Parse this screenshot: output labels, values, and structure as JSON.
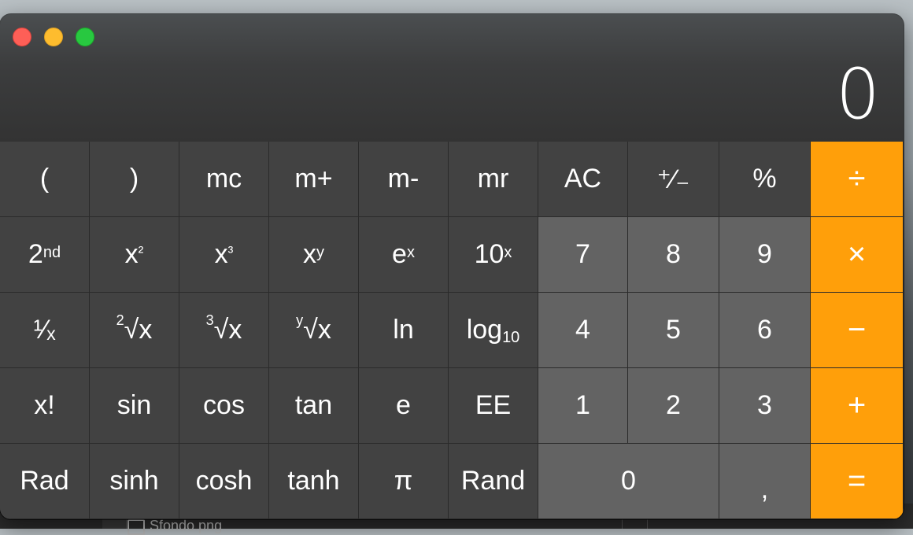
{
  "display": {
    "value": "0"
  },
  "row1": [
    "(",
    ")",
    "mc",
    "m+",
    "m-",
    "mr",
    "AC",
    "⁺∕₋",
    "%",
    "÷"
  ],
  "row2": {
    "second": {
      "base": "2",
      "sup": "nd"
    },
    "x2": {
      "base": "x",
      "sup": "²"
    },
    "x3": {
      "base": "x",
      "sup": "³"
    },
    "xy": {
      "base": "x",
      "sup": "y"
    },
    "ex": {
      "base": "e",
      "sup": "x"
    },
    "tenx": {
      "base": "10",
      "sup": "x"
    },
    "d7": "7",
    "d8": "8",
    "d9": "9",
    "mul": "×"
  },
  "row3": {
    "recip": "¹⁄ₓ",
    "sqrt2": {
      "pre": "2",
      "root": "√x"
    },
    "sqrt3": {
      "pre": "3",
      "root": "√x"
    },
    "sqrty": {
      "pre": "y",
      "root": "√x"
    },
    "ln": "ln",
    "log10": {
      "base": "log",
      "sub": "10"
    },
    "d4": "4",
    "d5": "5",
    "d6": "6",
    "sub": "−"
  },
  "row4": [
    "x!",
    "sin",
    "cos",
    "tan",
    "e",
    "EE",
    "1",
    "2",
    "3",
    "+"
  ],
  "row5": [
    "Rad",
    "sinh",
    "cosh",
    "tanh",
    "π",
    "Rand",
    "0",
    ",",
    "="
  ],
  "desktop": {
    "filename": "Sfondo.png"
  },
  "colors": {
    "operator": "#ff9f0a",
    "function_key": "#424242",
    "digit_key": "#636363"
  }
}
